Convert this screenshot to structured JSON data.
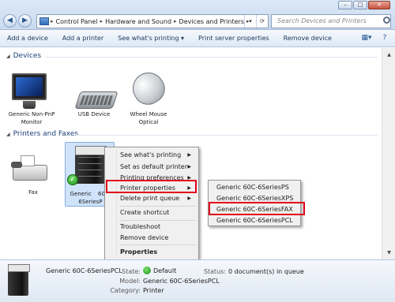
{
  "window": {
    "buttons": [
      "–",
      "□",
      "✕"
    ]
  },
  "address": {
    "crumbs": [
      "Control Panel",
      "Hardware and Sound",
      "Devices and Printers"
    ],
    "search_placeholder": "Search Devices and Printers"
  },
  "toolbar": {
    "items": [
      "Add a device",
      "Add a printer",
      "See what's printing ▾",
      "Print server properties",
      "Remove device"
    ]
  },
  "groups": {
    "devices_header": "Devices",
    "printers_header": "Printers and Faxes"
  },
  "devices": [
    {
      "label1": "Generic Non-PnP",
      "label2": "Monitor"
    },
    {
      "label1": "USB Device",
      "label2": ""
    },
    {
      "label1": "Wheel Mouse",
      "label2": "Optical"
    }
  ],
  "printers": {
    "fax": "Fax",
    "selected_label1": "Generic",
    "selected_label2": "60C-6SeriesP"
  },
  "context_menu": {
    "items": [
      "See what's printing",
      "Set as default printer",
      "Printing preferences",
      "Printer properties",
      "Delete print queue",
      "Create shortcut",
      "Troubleshoot",
      "Remove device",
      "Properties"
    ]
  },
  "submenu": {
    "items": [
      "Generic 60C-6SeriesPS",
      "Generic 60C-6SeriesXPS",
      "Generic 60C-6SeriesFAX",
      "Generic 60C-6SeriesPCL"
    ]
  },
  "details": {
    "title": "Generic 60C-6SeriesPCL",
    "state_label": "State:",
    "state_value": "Default",
    "status_label": "Status:",
    "status_value": "0 document(s) in queue",
    "model_label": "Model:",
    "model_value": "Generic 60C-6SeriesPCL",
    "category_label": "Category:",
    "category_value": "Printer"
  }
}
